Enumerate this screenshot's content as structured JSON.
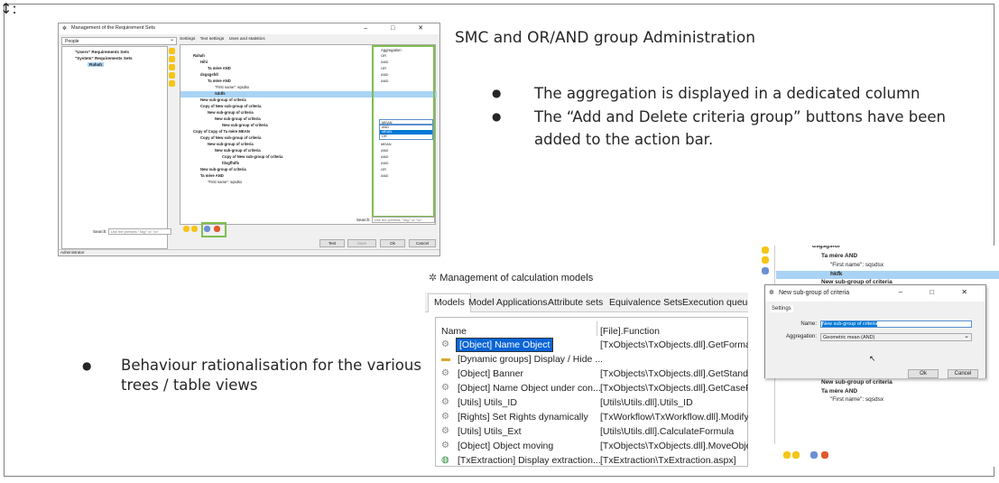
{
  "slide": {
    "title": "SMC and OR/AND group Administration",
    "bullets": [
      "The aggregation is displayed in a dedicated column",
      "The “Add and Delete criteria group” buttons have been added to the action bar."
    ],
    "bullet_behaviour": "Behaviour rationalisation for the various trees / table views"
  },
  "screen1": {
    "title": "Management of the Requirement Sets",
    "window_buttons": "– □ ✕",
    "combo_value": "People",
    "tabs": [
      "Settings",
      "Text settings",
      "Uses and statistics"
    ],
    "left_tree": [
      "\"Users\" Requirements Sets",
      "\"System\" Requirements Sets",
      "Rahah"
    ],
    "agg_header": "Aggregation",
    "rows": [
      {
        "label": "Rahah",
        "agg": "OR"
      },
      {
        "label": "Hihi",
        "agg": "AND"
      },
      {
        "label": "Ta mère AND",
        "agg": "OR"
      },
      {
        "label": "dsgsgsfdl",
        "agg": "AND"
      },
      {
        "label": "Ta mère AND",
        "agg": "AND"
      },
      {
        "label": "\"First name\": sqsdsx",
        "agg": ""
      },
      {
        "label": "Sddfs",
        "agg": ""
      },
      {
        "label": "New sub-group of criteria",
        "agg": "AND"
      },
      {
        "label": "Copy of New sub-group of criteria",
        "agg": "AND"
      },
      {
        "label": "New sub-group of criteria",
        "agg": "MEAN"
      },
      {
        "label": "New sub-group of criteria",
        "agg": "AND"
      },
      {
        "label": "New sub-group of criteria",
        "agg": "AND"
      },
      {
        "label": "Copy of Copy of Ta mère MEAN",
        "agg": "MEAN"
      },
      {
        "label": "Copy of New sub-group of criteria",
        "agg": "AND"
      },
      {
        "label": "New sub-group of criteria",
        "agg": "MEAN"
      },
      {
        "label": "New sub-group of criteria",
        "agg": "AND"
      },
      {
        "label": "Copy of New sub-group of criteria",
        "agg": "AND"
      },
      {
        "label": "fdsgfhdfs",
        "agg": "AND"
      },
      {
        "label": "New sub-group of criteria",
        "agg": "OR"
      },
      {
        "label": "Ta mère AND",
        "agg": "AND"
      },
      {
        "label": "\"First name\": sqsdsx",
        "agg": ""
      }
    ],
    "dropdown_value": "MEAN",
    "dropdown_options": [
      "AND",
      "MEAN",
      "OR"
    ],
    "dropdown_highlight": "MEAN",
    "search_label": "Search:",
    "search_placeholder": "Use the prefixes \"Tag:\" or \"Id:\"",
    "buttons": {
      "test": "Test",
      "save": "Save",
      "ok": "Ok",
      "cancel": "Cancel"
    },
    "status": "Administrator"
  },
  "screen2": {
    "title": "Management of calculation models",
    "tabs": [
      "Models",
      "Model Applications",
      "Attribute sets",
      "Equivalence Sets",
      "Execution queue"
    ],
    "col_name": "Name",
    "col_function": "[File].Function",
    "rows": [
      {
        "name": "[Object] Name Object",
        "func": "[TxObjects\\TxObjects.dll].GetFormate"
      },
      {
        "name": "[Dynamic groups] Display / Hide ...",
        "func": ""
      },
      {
        "name": "[Object] Banner",
        "func": "[TxObjects\\TxObjects.dll].GetStandarc"
      },
      {
        "name": "[Object] Name Object under con...",
        "func": "[TxObjects\\TxObjects.dll].GetCaseFor"
      },
      {
        "name": "[Utils] Utils_ID",
        "func": "[Utils\\Utils.dll].Utils_ID"
      },
      {
        "name": "[Rights] Set Rights dynamically",
        "func": "[TxWorkflow\\TxWorkflow.dll].ModifyOl"
      },
      {
        "name": "[Utils] Utils_Ext",
        "func": "[Utils\\Utils.dll].CalculateFormula"
      },
      {
        "name": "[Object] Object moving",
        "func": "[TxObjects\\TxObjects.dll].MoveObject"
      },
      {
        "name": "[TxExtraction] Display extraction...",
        "func": "[TxExtraction\\TxExtraction.aspx]"
      }
    ],
    "scroll_marker": "↕:"
  },
  "screen3": {
    "tree_top": [
      "dsgsgsfdl",
      "Ta mère AND",
      "\"First name\": sqsdsx",
      "hkfk",
      "New sub-group of criteria"
    ],
    "tree_bottom": [
      "New sub-group of criteria",
      "Ta mère AND",
      "\"First name\": sqsdsx"
    ],
    "dialog_title": "New sub-group of criteria",
    "dialog_window_buttons": "– □ ✕",
    "dialog_tab": "Settings",
    "name_label": "Name:",
    "name_value": "New sub-group of criteria",
    "agg_label": "Aggregation:",
    "agg_value": "Geometric mean (AND)",
    "ok": "Ok",
    "cancel": "Cancel"
  }
}
